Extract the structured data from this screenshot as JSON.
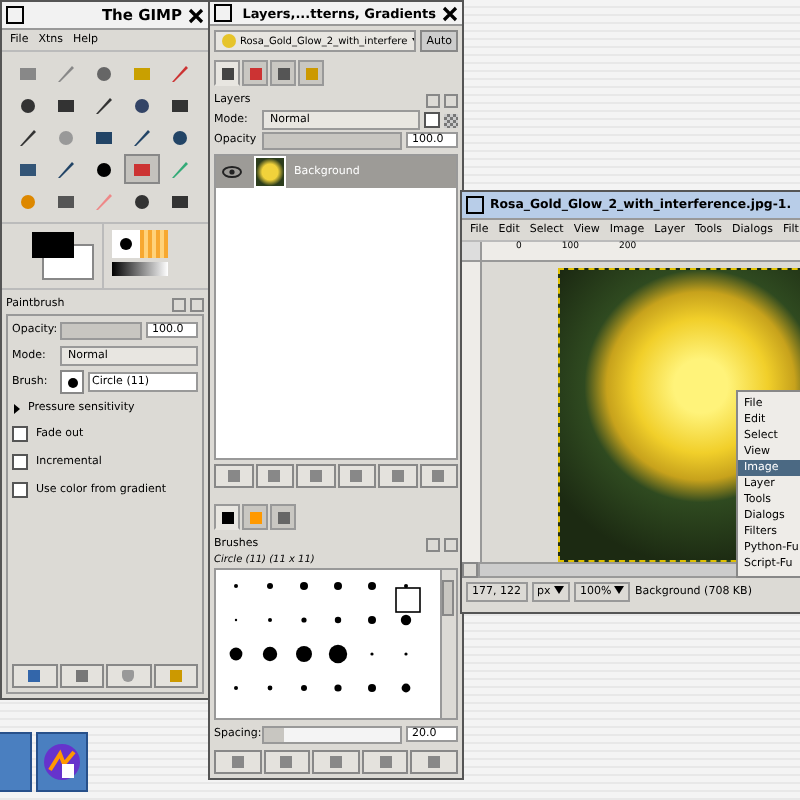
{
  "toolbox": {
    "title": "The GIMP",
    "menu": [
      "File",
      "Xtns",
      "Help"
    ],
    "tools": [
      {
        "selected": false
      },
      {
        "selected": false
      },
      {
        "selected": false
      },
      {
        "selected": false
      },
      {
        "selected": false
      },
      {
        "selected": false
      },
      {
        "selected": false
      },
      {
        "selected": false
      },
      {
        "selected": false
      },
      {
        "selected": false
      },
      {
        "selected": false
      },
      {
        "selected": false
      },
      {
        "selected": false
      },
      {
        "selected": false
      },
      {
        "selected": false
      },
      {
        "selected": false
      },
      {
        "selected": false
      },
      {
        "selected": false
      },
      {
        "selected": true
      },
      {
        "selected": false
      },
      {
        "selected": false
      },
      {
        "selected": false
      },
      {
        "selected": false
      },
      {
        "selected": false
      },
      {
        "selected": false
      }
    ],
    "tool_options": {
      "title": "Paintbrush",
      "opacity_label": "Opacity:",
      "opacity": "100.0",
      "opacity_slider": {
        "level": 1
      },
      "mode_label": "Mode:",
      "mode": "Normal",
      "brush_label": "Brush:",
      "brush": "Circle (11)",
      "expander": "Pressure sensitivity",
      "expanded": false,
      "options": [
        {
          "label": "Fade out",
          "checked": false
        },
        {
          "label": "Incremental",
          "checked": false
        },
        {
          "label": "Use color from gradient",
          "checked": false
        }
      ]
    }
  },
  "dock": {
    "title": "Layers,...tterns, Gradients",
    "image": "Rosa_Gold_Glow_2_with_interfere",
    "auto": "Auto",
    "tabs": [
      {
        "selected": true
      },
      {
        "selected": false
      },
      {
        "selected": false
      },
      {
        "selected": false
      }
    ],
    "layers": {
      "title": "Layers",
      "mode_label": "Mode:",
      "mode": "Normal",
      "keep_transparency": false,
      "opacity_label": "Opacity",
      "opacity": "100.0",
      "opacity_slider": {
        "level": 1
      },
      "rows": [
        {
          "name": "Background",
          "visible": true,
          "selected": true
        }
      ]
    },
    "resource_tabs": [
      {
        "selected": true
      },
      {
        "selected": false
      },
      {
        "selected": false
      }
    ],
    "brushes": {
      "title": "Brushes",
      "current": "Circle (11) (11 x 11)",
      "spacing_label": "Spacing:",
      "spacing": "20.0",
      "spacing_slider": {
        "level": 0.15
      }
    }
  },
  "image_window": {
    "title": "Rosa_Gold_Glow_2_with_interference.jpg-1.",
    "menu": [
      "File",
      "Edit",
      "Select",
      "View",
      "Image",
      "Layer",
      "Tools",
      "Dialogs",
      "Filt"
    ],
    "ruler_labels": [
      "0",
      "100",
      "200"
    ],
    "coords": "177, 122",
    "unit": "px",
    "zoom": "100%",
    "status": "Background (708 KB)"
  },
  "context_menu": [
    {
      "label": "File",
      "selected": false
    },
    {
      "label": "Edit",
      "selected": false
    },
    {
      "label": "Select",
      "selected": false
    },
    {
      "label": "View",
      "selected": false
    },
    {
      "label": "Image",
      "selected": true
    },
    {
      "label": "Layer",
      "selected": false
    },
    {
      "label": "Tools",
      "selected": false
    },
    {
      "label": "Dialogs",
      "selected": false
    },
    {
      "label": "Filters",
      "selected": false
    },
    {
      "label": "Python-Fu",
      "selected": false
    },
    {
      "label": "Script-Fu",
      "selected": false
    }
  ]
}
